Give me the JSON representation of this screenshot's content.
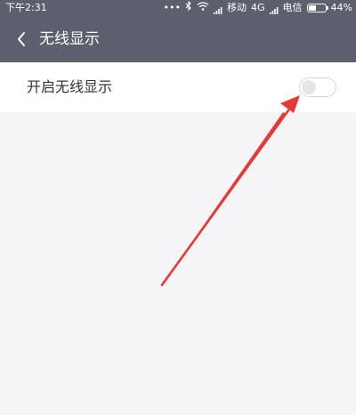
{
  "status_bar": {
    "time": "下午2:31",
    "dots": "•••",
    "network_type": "4G",
    "carrier_1": "移动",
    "carrier_2": "电信",
    "battery_percent_text": "44%",
    "battery_level": 0.44
  },
  "header": {
    "title": "无线显示"
  },
  "settings": {
    "wireless_display_label": "开启无线显示",
    "wireless_display_enabled": false
  },
  "colors": {
    "header_bg": "#5b5f6e",
    "page_bg": "#f5f4f7",
    "row_bg": "#ffffff",
    "annotation_arrow": "#e53935"
  },
  "icons": {
    "back": "chevron-left-icon",
    "bluetooth": "bluetooth-icon",
    "wifi": "wifi-icon",
    "signal": "signal-icon",
    "battery": "battery-icon"
  }
}
